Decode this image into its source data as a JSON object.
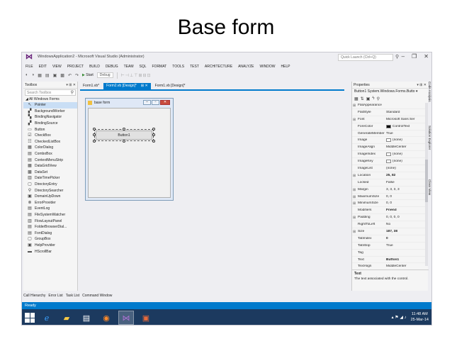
{
  "slide": {
    "title": "Base form"
  },
  "window": {
    "title": "WindowsApplication2 - Microsoft Visual Studio (Administrator)",
    "quick_launch_placeholder": "Quick Launch (Ctrl+Q)"
  },
  "menu": [
    "FILE",
    "EDIT",
    "VIEW",
    "PROJECT",
    "BUILD",
    "DEBUG",
    "TEAM",
    "SQL",
    "FORMAT",
    "TOOLS",
    "TEST",
    "ARCHITECTURE",
    "ANALYZE",
    "WINDOW",
    "HELP"
  ],
  "toolbar": {
    "start_label": "Start",
    "config": "Debug"
  },
  "toolbox": {
    "title": "Toolbox",
    "controls": "▾ ⊞ ✕",
    "search_placeholder": "Search Toolbox",
    "group": "◢ All Windows Forms",
    "items": [
      {
        "label": "Pointer",
        "icon": "pointer-icon",
        "glyph": "↖"
      },
      {
        "label": "BackgroundWorker",
        "icon": "background-worker-icon",
        "glyph": "▞"
      },
      {
        "label": "BindingNavigator",
        "icon": "binding-navigator-icon",
        "glyph": "▚"
      },
      {
        "label": "BindingSource",
        "icon": "binding-source-icon",
        "glyph": "▞"
      },
      {
        "label": "Button",
        "icon": "button-icon",
        "glyph": "▭"
      },
      {
        "label": "CheckBox",
        "icon": "checkbox-icon",
        "glyph": "☑"
      },
      {
        "label": "CheckedListBox",
        "icon": "checked-listbox-icon",
        "glyph": "☷"
      },
      {
        "label": "ColorDialog",
        "icon": "color-dialog-icon",
        "glyph": "▦"
      },
      {
        "label": "ComboBox",
        "icon": "combobox-icon",
        "glyph": "▤"
      },
      {
        "label": "ContextMenuStrip",
        "icon": "context-menu-icon",
        "glyph": "▤"
      },
      {
        "label": "DataGridView",
        "icon": "datagridview-icon",
        "glyph": "▦"
      },
      {
        "label": "DataSet",
        "icon": "dataset-icon",
        "glyph": "▩"
      },
      {
        "label": "DateTimePicker",
        "icon": "datetimepicker-icon",
        "glyph": "▥"
      },
      {
        "label": "DirectoryEntry",
        "icon": "directory-entry-icon",
        "glyph": "▢"
      },
      {
        "label": "DirectorySearcher",
        "icon": "directory-searcher-icon",
        "glyph": "⚲"
      },
      {
        "label": "DomainUpDown",
        "icon": "domain-updown-icon",
        "glyph": "▣"
      },
      {
        "label": "ErrorProvider",
        "icon": "error-provider-icon",
        "glyph": "⊗"
      },
      {
        "label": "EventLog",
        "icon": "eventlog-icon",
        "glyph": "▤"
      },
      {
        "label": "FileSystemWatcher",
        "icon": "filesystemwatcher-icon",
        "glyph": "▤"
      },
      {
        "label": "FlowLayoutPanel",
        "icon": "flowlayoutpanel-icon",
        "glyph": "▥"
      },
      {
        "label": "FolderBrowserDial...",
        "icon": "folder-browser-icon",
        "glyph": "▤"
      },
      {
        "label": "FontDialog",
        "icon": "font-dialog-icon",
        "glyph": "▤"
      },
      {
        "label": "GroupBox",
        "icon": "groupbox-icon",
        "glyph": "▢"
      },
      {
        "label": "HelpProvider",
        "icon": "help-provider-icon",
        "glyph": "▣"
      },
      {
        "label": "HScrollBar",
        "icon": "hscrollbar-icon",
        "glyph": "▬"
      }
    ]
  },
  "tabs": [
    {
      "label": "Form1.vb*",
      "active": false
    },
    {
      "label": "Form2.vb [Design]*",
      "active": true
    },
    {
      "label": "Form1.vb [Design]*",
      "active": false
    }
  ],
  "designer": {
    "form_title": "base form",
    "button_text": "Button1"
  },
  "properties": {
    "title": "Properties",
    "controls": "▾ ⊞ ✕",
    "object": "Button1 System.Windows.Forms.Butto ▾",
    "rows": [
      {
        "name": "FlatAppearance",
        "value": "",
        "category": true
      },
      {
        "name": "FlatStyle",
        "value": "Standard"
      },
      {
        "name": "Font",
        "value": "Microsoft Sans Ser",
        "category": true
      },
      {
        "name": "ForeColor",
        "value": "ControlText",
        "swatch": "#000000"
      },
      {
        "name": "GenerateMember",
        "value": "True"
      },
      {
        "name": "Image",
        "value": "(none)",
        "swatch": "#ffffff"
      },
      {
        "name": "ImageAlign",
        "value": "MiddleCenter"
      },
      {
        "name": "ImageIndex",
        "value": "(none)",
        "swatch": "#ffffff"
      },
      {
        "name": "ImageKey",
        "value": "(none)",
        "swatch": "#ffffff"
      },
      {
        "name": "ImageList",
        "value": "(none)"
      },
      {
        "name": "Location",
        "value": "25, 82",
        "category": true,
        "bold": true
      },
      {
        "name": "Locked",
        "value": "False"
      },
      {
        "name": "Margin",
        "value": "3, 3, 3, 3",
        "category": true
      },
      {
        "name": "MaximumSize",
        "value": "0, 0",
        "category": true
      },
      {
        "name": "MinimumSize",
        "value": "0, 0",
        "category": true
      },
      {
        "name": "Modifiers",
        "value": "Friend",
        "bold": true
      },
      {
        "name": "Padding",
        "value": "0, 0, 0, 0",
        "category": true
      },
      {
        "name": "RightToLeft",
        "value": "No"
      },
      {
        "name": "Size",
        "value": "187, 38",
        "category": true,
        "bold": true
      },
      {
        "name": "TabIndex",
        "value": "0",
        "bold": true
      },
      {
        "name": "TabStop",
        "value": "True"
      },
      {
        "name": "Tag",
        "value": ""
      },
      {
        "name": "Text",
        "value": "Button1",
        "bold": true
      },
      {
        "name": "TextAlign",
        "value": "MiddleCenter"
      }
    ],
    "desc_title": "Text",
    "desc_text": "The text associated with the control."
  },
  "side_tabs": [
    "Code Analysis",
    "Solution Explorer",
    "Class View"
  ],
  "bottom_tabs": [
    "Call Hierarchy",
    "Error List",
    "Task List",
    "Command Window"
  ],
  "status": "Ready",
  "taskbar": {
    "time": "11:48 AM",
    "date": "25-Mar-14"
  }
}
